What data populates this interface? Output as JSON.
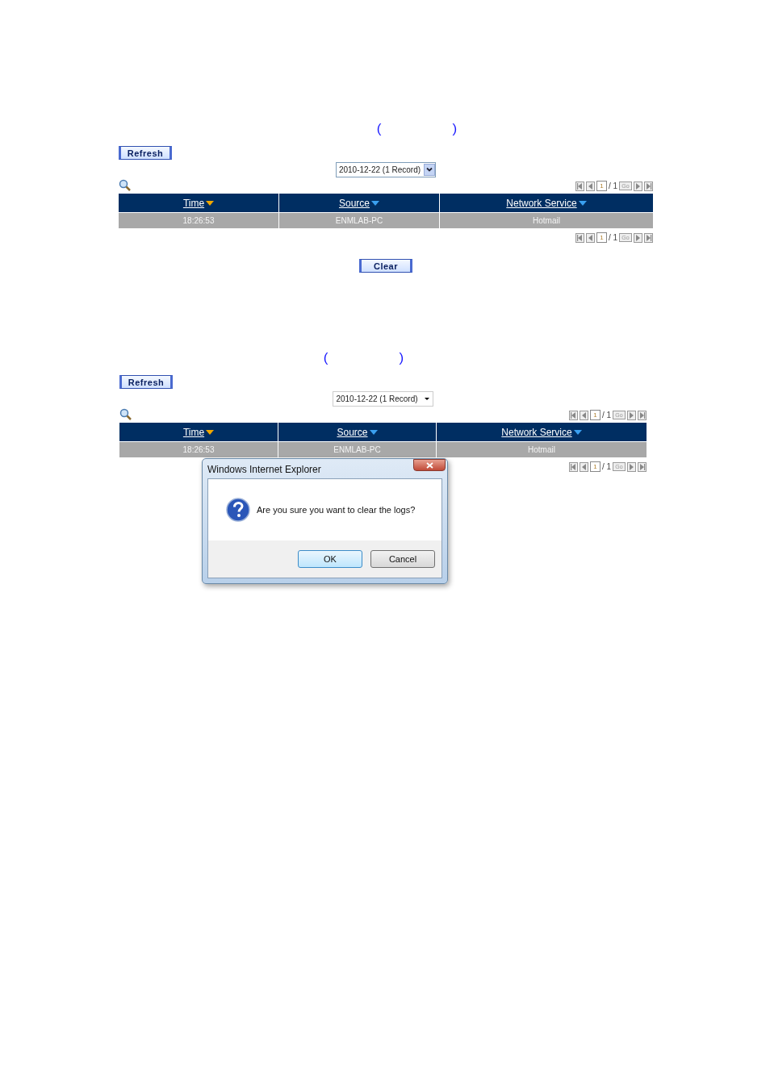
{
  "sections": [
    {
      "heading": {
        "open": "(",
        "close": ")"
      },
      "refresh": "Refresh",
      "date_select": {
        "value": "2010-12-22 (1 Record)",
        "kind": "classic"
      },
      "pager_top": {
        "page": "1",
        "total": "/ 1",
        "go": "Go"
      },
      "columns": [
        {
          "label": "Time",
          "sorted": true
        },
        {
          "label": "Source",
          "sorted": false
        },
        {
          "label": "Network Service",
          "sorted": false
        }
      ],
      "rows": [
        [
          "18:26:53",
          "ENMLAB-PC",
          "Hotmail"
        ]
      ],
      "pager_bottom": {
        "page": "1",
        "total": "/ 1",
        "go": "Go"
      },
      "clear": "Clear"
    },
    {
      "heading": {
        "open": "(",
        "close": ")"
      },
      "refresh": "Refresh",
      "date_select": {
        "value": "2010-12-22 (1 Record)",
        "kind": "plain"
      },
      "pager_top": {
        "page": "1",
        "total": "/ 1",
        "go": "Go"
      },
      "columns": [
        {
          "label": "Time",
          "sorted": true
        },
        {
          "label": "Source",
          "sorted": false
        },
        {
          "label": "Network Service",
          "sorted": false
        }
      ],
      "rows": [
        [
          "18:26:53",
          "ENMLAB-PC",
          "Hotmail"
        ]
      ],
      "pager_bottom": {
        "page": "1",
        "total": "/ 1",
        "go": "Go"
      },
      "dialog": {
        "title": "Windows Internet Explorer",
        "message": "Are you sure you want to clear the logs?",
        "buttons": [
          {
            "label": "OK",
            "selected": true
          },
          {
            "label": "Cancel",
            "selected": false
          }
        ]
      }
    }
  ]
}
